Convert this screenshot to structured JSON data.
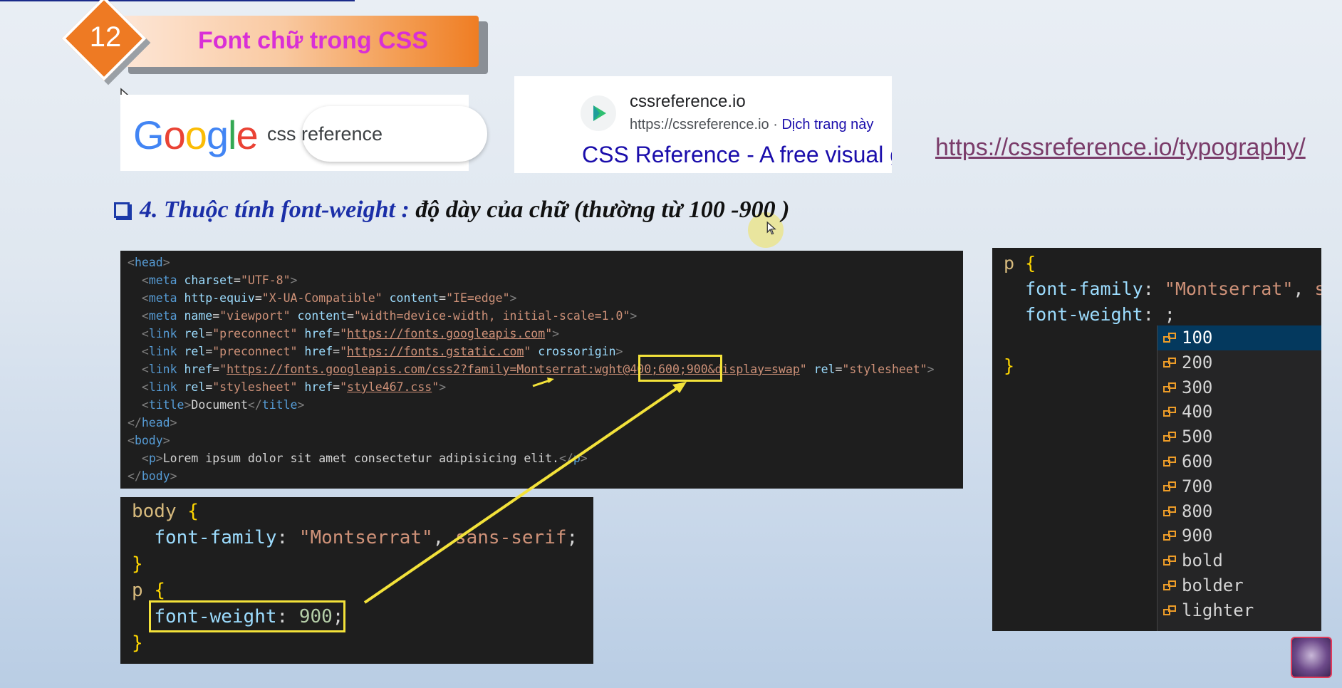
{
  "slide": {
    "number": "12",
    "title": "Font chữ trong CSS",
    "link": "https://cssreference.io/typography/",
    "heading_prefix": "4. Thuộc tính font-weight :",
    "heading_suffix": " độ dày của chữ (thường từ 100 -900 )"
  },
  "google": {
    "logo_letters": [
      "G",
      "o",
      "o",
      "g",
      "l",
      "e"
    ],
    "logo_colors": [
      "#4285f4",
      "#ea4335",
      "#fbbc05",
      "#4285f4",
      "#34a853",
      "#ea4335"
    ],
    "search_text": "css reference"
  },
  "search_result": {
    "site_name": "cssreference.io",
    "url": "https://cssreference.io",
    "separator": " · ",
    "translate": "Dịch trang này",
    "title": "CSS Reference - A free visual guide"
  },
  "html_code": {
    "head_open": "head",
    "meta1_attr": "charset",
    "meta1_val": "\"UTF-8\"",
    "meta2_attr1": "http-equiv",
    "meta2_val1": "\"X-UA-Compatible\"",
    "meta2_attr2": "content",
    "meta2_val2": "\"IE=edge\"",
    "meta3_attr1": "name",
    "meta3_val1": "\"viewport\"",
    "meta3_attr2": "content",
    "meta3_val2": "\"width=device-width, initial-scale=1.0\"",
    "link1_attr1": "rel",
    "link1_val1": "\"preconnect\"",
    "link1_attr2": "href",
    "link1_url": "https://fonts.googleapis.com",
    "link2_attr1": "rel",
    "link2_val1": "\"preconnect\"",
    "link2_attr2": "href",
    "link2_url": "https://fonts.gstatic.com",
    "link2_attr3": "crossorigin",
    "link3_attr1": "href",
    "link3_url": "https://fonts.googleapis.com/css2?family=Montserrat:wght@400;600;900&display=swap",
    "link3_attr2": "rel",
    "link3_val2": "\"stylesheet\"",
    "link4_attr1": "rel",
    "link4_val1": "\"stylesheet\"",
    "link4_attr2": "href",
    "link4_url": "style467.css",
    "title_tag": "title",
    "title_text": "Document",
    "body_tag": "body",
    "p_tag": "p",
    "p_text": "Lorem ipsum dolor sit amet consectetur adipisicing elit."
  },
  "css_code": {
    "body_selector": "body",
    "prop_family": "font-family",
    "family_value": "\"Montserrat\"",
    "family_fallback": "sans-serif",
    "p_selector": "p",
    "prop_weight": "font-weight",
    "weight_value": "900"
  },
  "editor": {
    "selector": "p",
    "prop_family": "font-family",
    "family_value": "\"Montserrat\"",
    "family_fallback": "sans-serif",
    "prop_weight": "font-weight",
    "suggestions": [
      "100",
      "200",
      "300",
      "400",
      "500",
      "600",
      "700",
      "800",
      "900",
      "bold",
      "bolder",
      "lighter"
    ],
    "selected_index": 0
  },
  "colors": {
    "accent_orange": "#ee7a23",
    "title_pink": "#d92fd6",
    "arrow_yellow": "#f3e23a"
  }
}
